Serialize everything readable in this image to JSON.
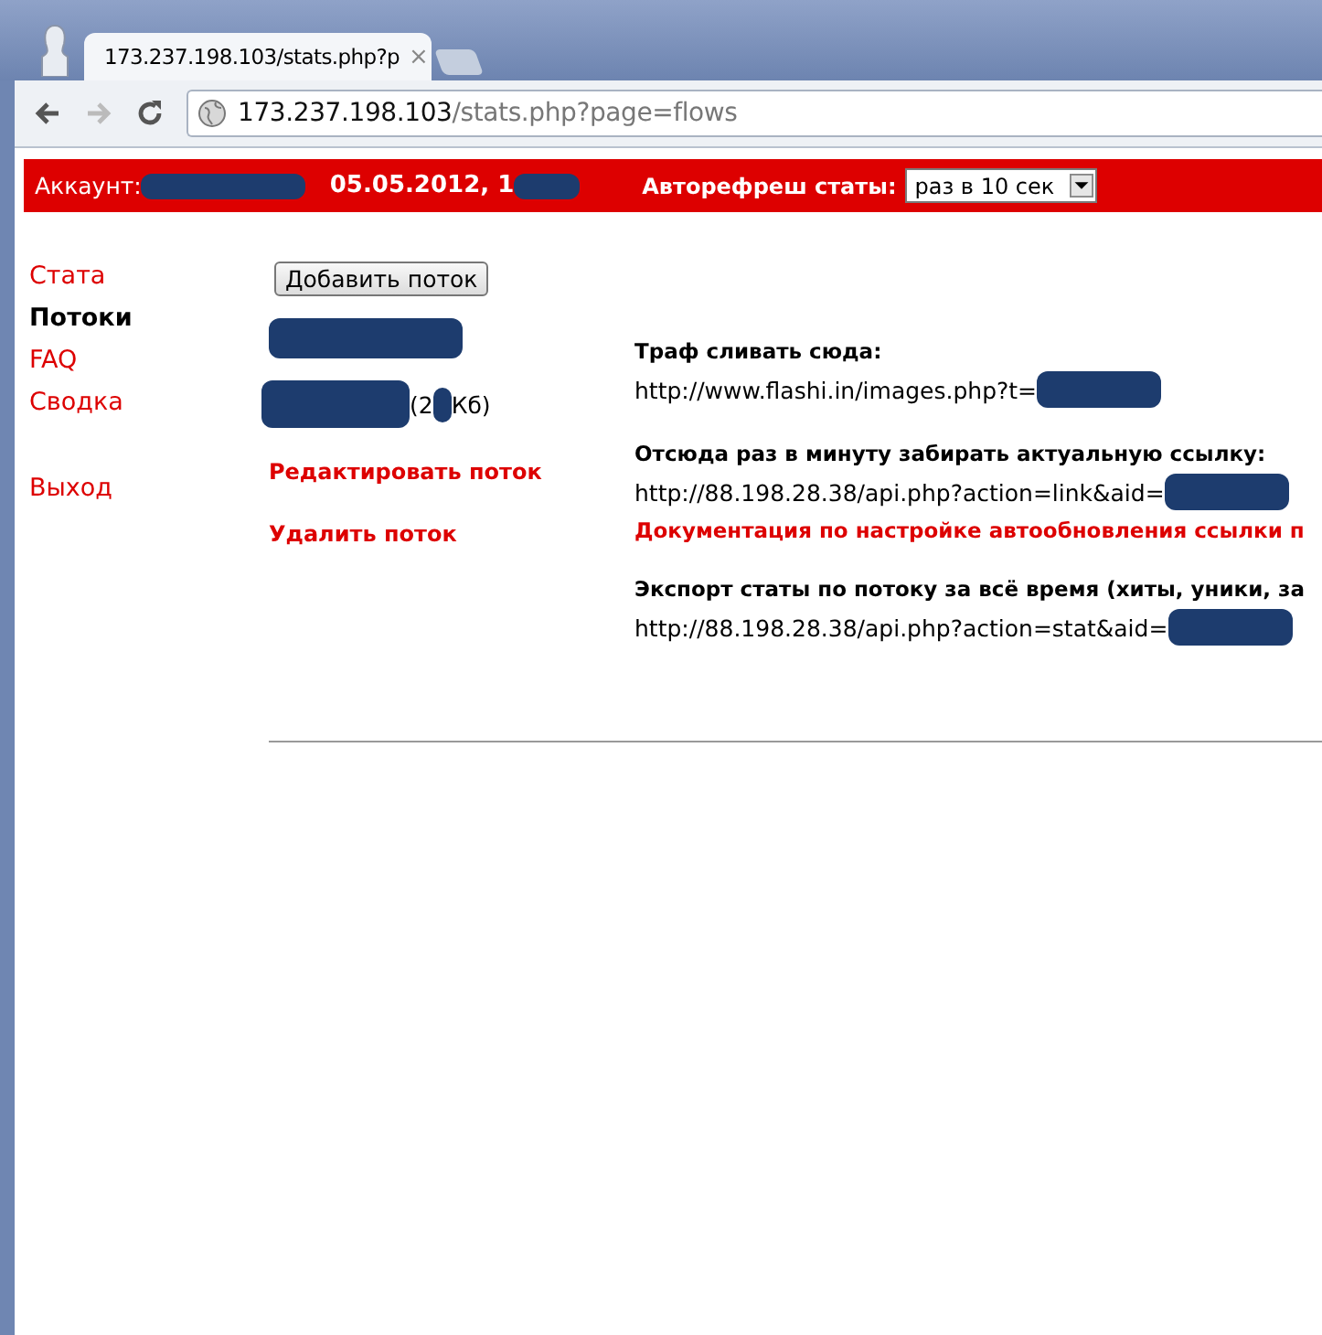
{
  "browser": {
    "tab_title": "173.237.198.103/stats.php?p",
    "tab_close": "×",
    "address_host": "173.237.198.103",
    "address_path": "/stats.php?page=flows"
  },
  "header": {
    "account_label": "Аккаунт:",
    "date": "05.05.2012, 1",
    "autorefresh_label": "Авторефреш статы:",
    "autorefresh_value": "раз в 10 сек"
  },
  "nav": [
    {
      "label": "Стата",
      "selected": false
    },
    {
      "label": "Потоки",
      "selected": true
    },
    {
      "label": "FAQ",
      "selected": false
    },
    {
      "label": "Сводка",
      "selected": false
    },
    {
      "label": "Выход",
      "selected": false
    }
  ],
  "flow": {
    "add_button": "Добавить поток",
    "size_open": "(2",
    "size_close": "Кб)",
    "edit_link": "Редактировать поток",
    "delete_link": "Удалить поток"
  },
  "info": [
    {
      "title": "Траф сливать сюда:",
      "url": "http://www.flashi.in/images.php?t="
    },
    {
      "title": "Отсюда раз в минуту забирать актуальную ссылку:",
      "url": "http://88.198.28.38/api.php?action=link&aid=",
      "link": "Документация по настройке автообновления ссылки п"
    },
    {
      "title": "Экспорт статы по потоку за всё время (хиты, уники, за",
      "url": "http://88.198.28.38/api.php?action=stat&aid="
    }
  ]
}
